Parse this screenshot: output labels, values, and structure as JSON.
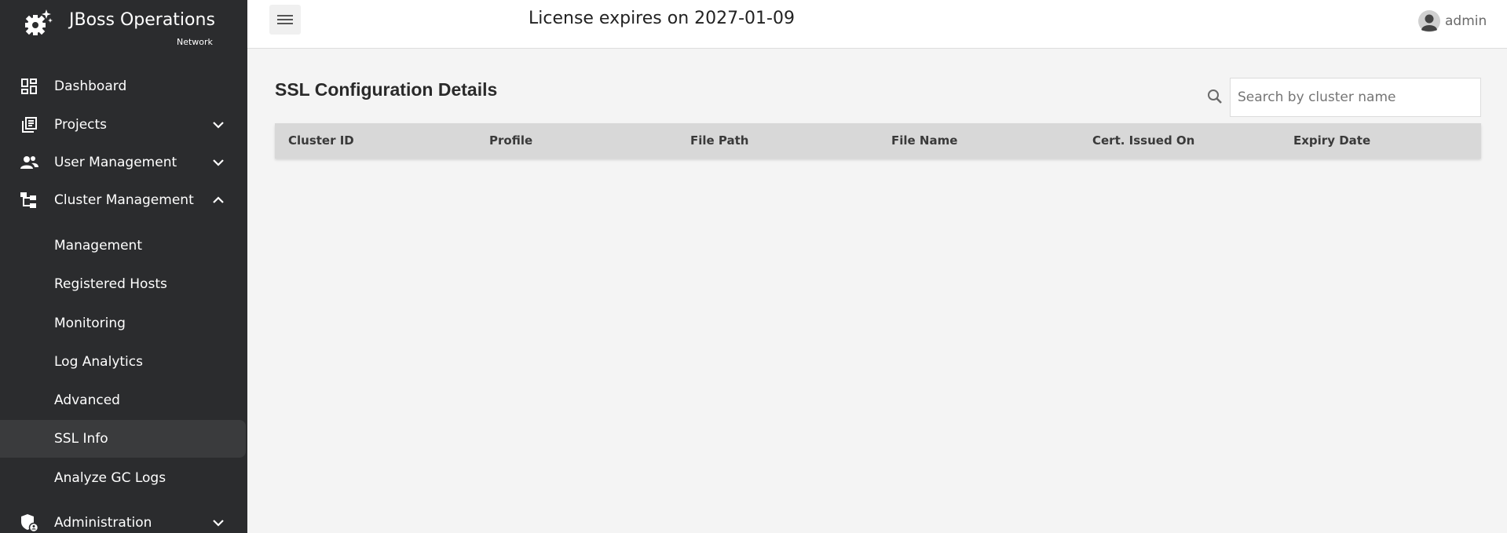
{
  "brand": {
    "title": "JBoss Operations",
    "subtitle": "Network"
  },
  "header": {
    "license_text": "License expires on 2027-01-09",
    "user_name": "admin"
  },
  "sidebar": {
    "items": [
      {
        "label": "Dashboard",
        "icon": "dashboard-icon"
      },
      {
        "label": "Projects",
        "icon": "projects-icon",
        "chevron": "down"
      },
      {
        "label": "User Management",
        "icon": "users-icon",
        "chevron": "down"
      },
      {
        "label": "Cluster Management",
        "icon": "cluster-icon",
        "chevron": "up"
      },
      {
        "label": "Administration",
        "icon": "admin-shield-icon",
        "chevron": "down"
      }
    ],
    "cluster_subitems": [
      {
        "label": "Management"
      },
      {
        "label": "Registered Hosts"
      },
      {
        "label": "Monitoring"
      },
      {
        "label": "Log Analytics"
      },
      {
        "label": "Advanced"
      },
      {
        "label": "SSL Info",
        "active": true
      },
      {
        "label": "Analyze GC Logs"
      }
    ]
  },
  "main": {
    "title": "SSL Configuration Details",
    "search": {
      "placeholder": "Search by cluster name",
      "value": ""
    },
    "table": {
      "columns": [
        "Cluster ID",
        "Profile",
        "File Path",
        "File Name",
        "Cert. Issued On",
        "Expiry Date"
      ],
      "rows": []
    }
  },
  "colors": {
    "sidebar_bg": "#2b2c2e",
    "active_item_bg": "#3a3b3d",
    "content_bg": "#f4f4f4",
    "table_header_bg": "#d8d8d8"
  }
}
